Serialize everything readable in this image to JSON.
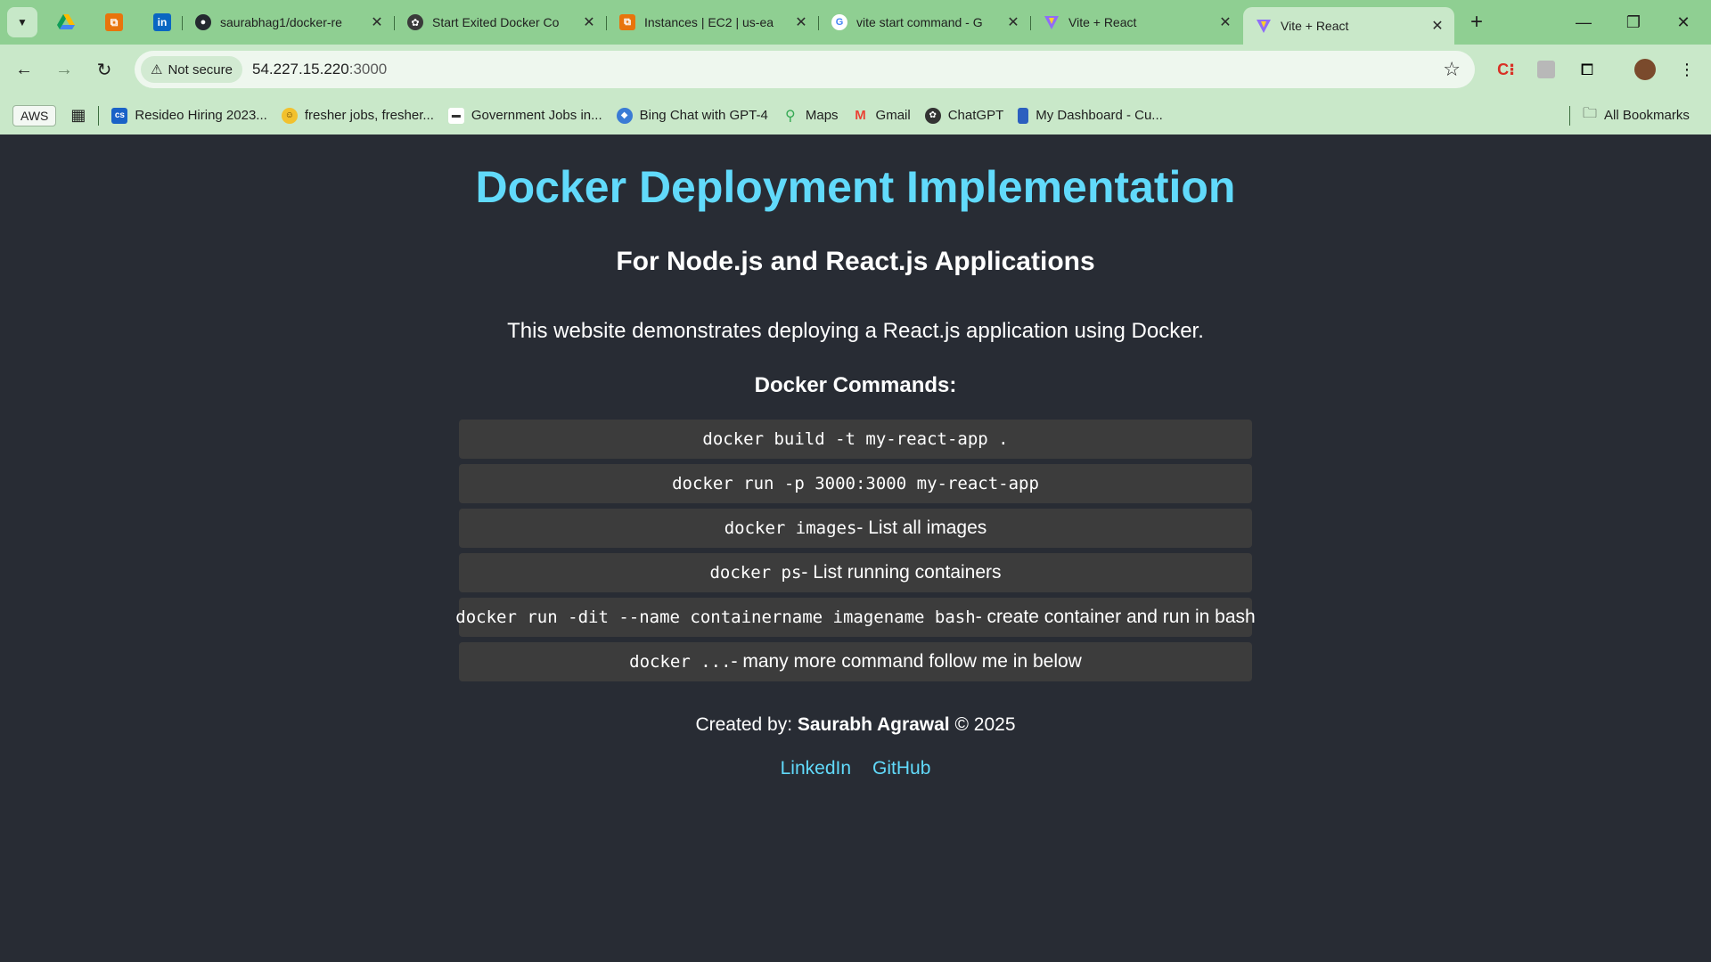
{
  "browser": {
    "pinned_tabs": [
      "google-drive-icon",
      "aws-icon",
      "linkedin-icon"
    ],
    "tabs": [
      {
        "label": "saurabhag1/docker-re",
        "icon": "github-icon"
      },
      {
        "label": "Start Exited Docker Co",
        "icon": "chatgpt-icon"
      },
      {
        "label": "Instances | EC2 | us-ea",
        "icon": "aws-icon"
      },
      {
        "label": "vite start command - G",
        "icon": "google-icon"
      },
      {
        "label": "Vite + React",
        "icon": "vite-icon"
      },
      {
        "label": "Vite + React",
        "icon": "vite-icon",
        "active": true
      }
    ],
    "security_label": "Not secure",
    "url_host": "54.227.15.220",
    "url_port": ":3000",
    "bookmarks": {
      "aws": "AWS",
      "items": [
        {
          "label": "Resideo Hiring 2023...",
          "icon": "cs-icon",
          "color": "#1a62c7"
        },
        {
          "label": "fresher jobs, fresher...",
          "icon": "smiley-icon",
          "color": "#f2c12e"
        },
        {
          "label": "Government Jobs in...",
          "icon": "govjobs-icon",
          "color": "#ffffff"
        },
        {
          "label": "Bing Chat with GPT-4",
          "icon": "bing-icon",
          "color": "#3a7bd5"
        },
        {
          "label": "Maps",
          "icon": "maps-pin-icon",
          "color": "#34a853"
        },
        {
          "label": "Gmail",
          "icon": "gmail-icon",
          "color": "#ea4335"
        },
        {
          "label": "ChatGPT",
          "icon": "chatgpt-icon",
          "color": "#333333"
        },
        {
          "label": "My Dashboard - Cu...",
          "icon": "dashboard-icon",
          "color": "#2b5fbf"
        }
      ],
      "all_bookmarks": "All Bookmarks"
    }
  },
  "page": {
    "title": "Docker Deployment Implementation",
    "subtitle": "For Node.js and React.js Applications",
    "description": "This website demonstrates deploying a React.js application using Docker.",
    "commands_heading": "Docker Commands:",
    "commands": [
      {
        "code": "docker build -t my-react-app .",
        "text": ""
      },
      {
        "code": "docker run -p 3000:3000 my-react-app",
        "text": ""
      },
      {
        "code": "docker images",
        "text": " - List all images"
      },
      {
        "code": "docker ps",
        "text": " - List running containers"
      },
      {
        "code": "docker run -dit --name containername imagename bash",
        "text": " - create container and run in bash"
      },
      {
        "code": "docker ...",
        "text": " - many more command follow me in below"
      }
    ],
    "credit_prefix": "Created by: ",
    "credit_name": "Saurabh Agrawal",
    "credit_suffix": " © 2025",
    "links": {
      "linkedin": "LinkedIn",
      "github": "GitHub"
    }
  },
  "colors": {
    "page_bg": "#282c34",
    "accent": "#61dafb",
    "command_bg": "#3c3c3c",
    "chrome": "#8fcf92"
  }
}
